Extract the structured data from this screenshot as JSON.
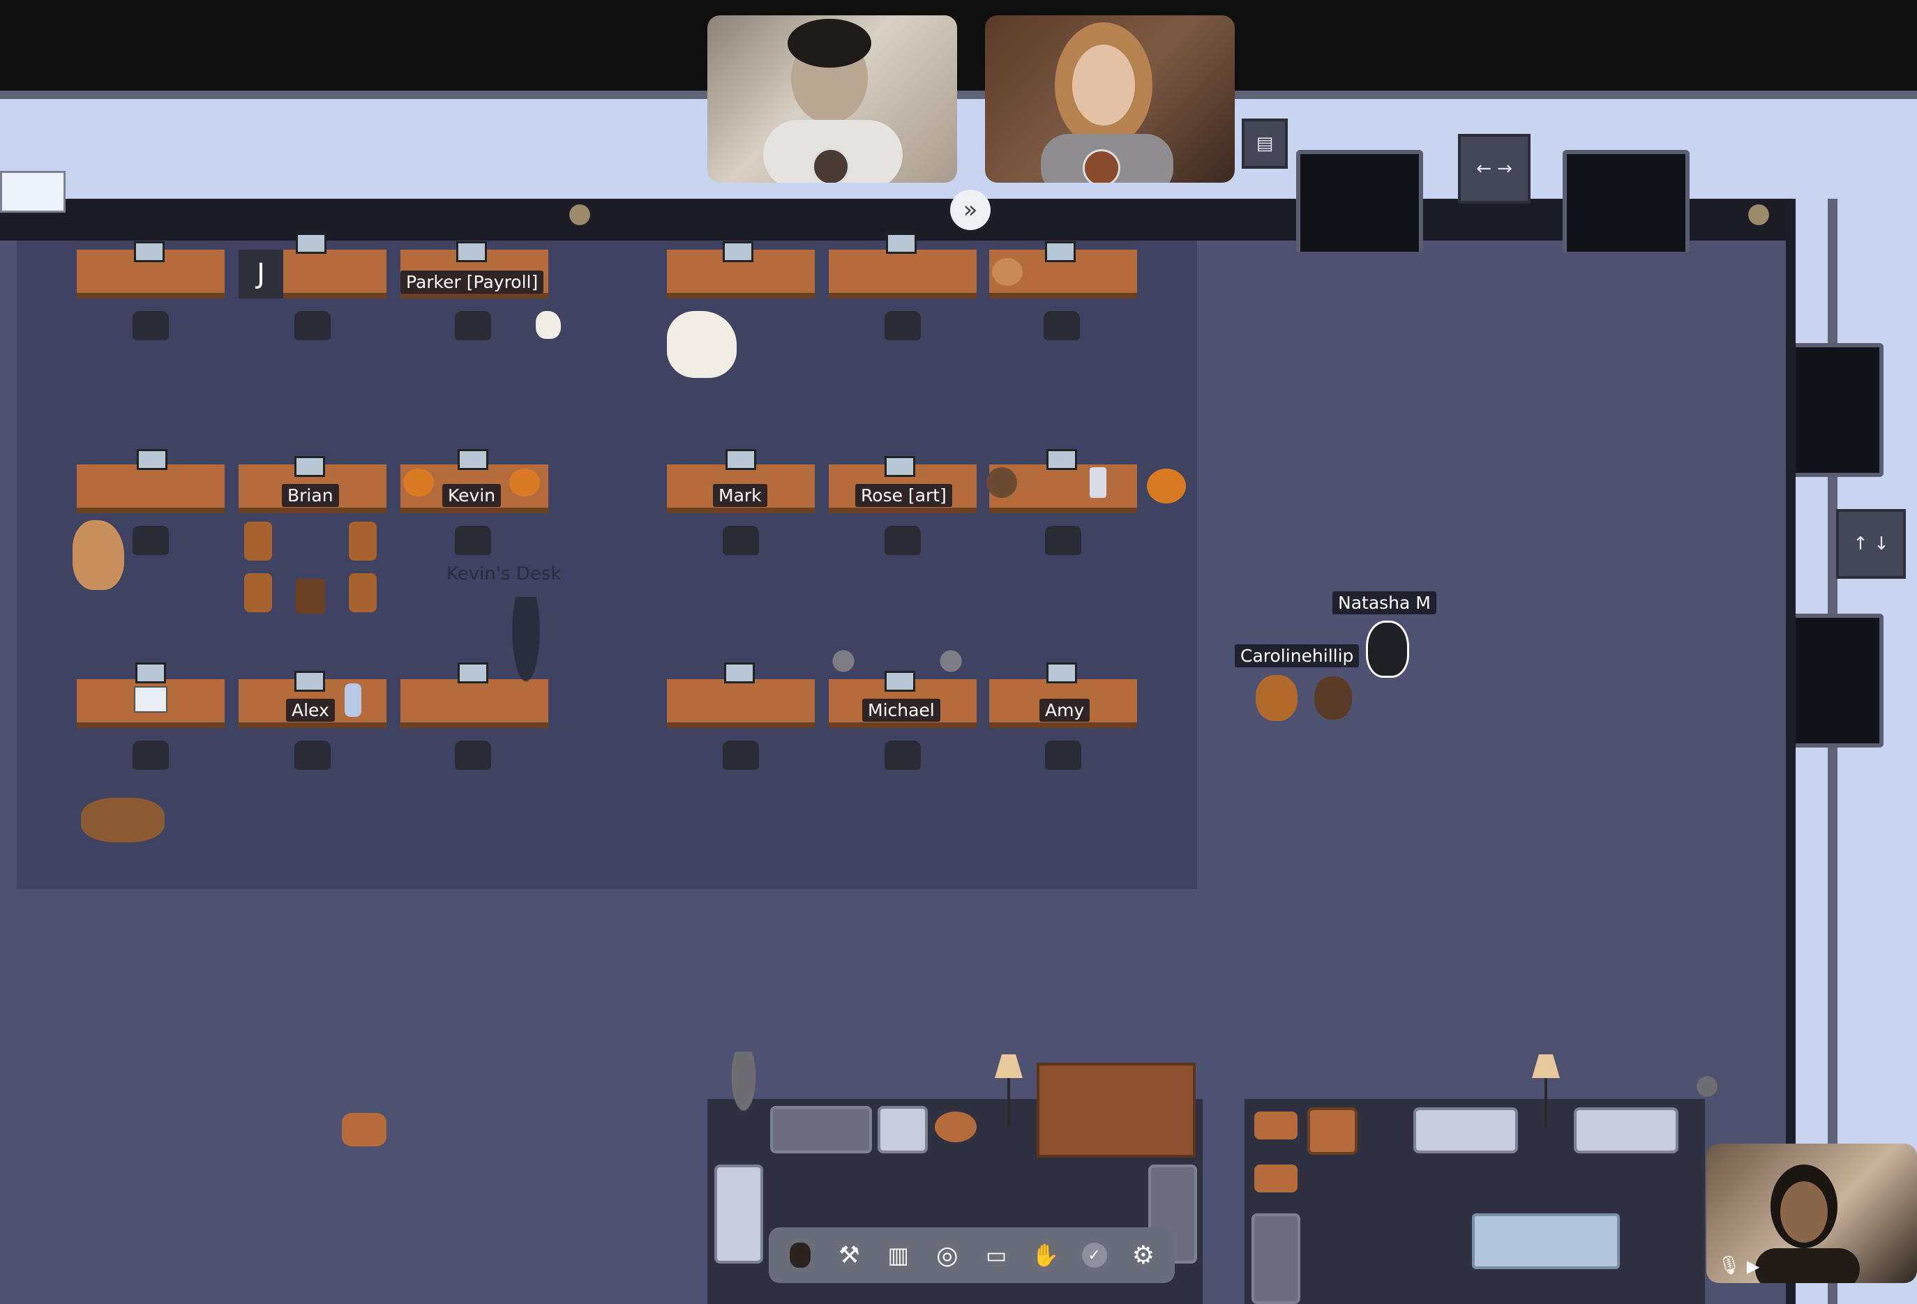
{
  "office": {
    "desk_labels": {
      "parker": "Parker [Payroll]",
      "brian": "Brian",
      "kevin": "Kevin",
      "mark": "Mark",
      "rose": "Rose [art]",
      "alex": "Alex",
      "michael": "Michael",
      "amy": "Amy",
      "j_initial": "J"
    },
    "kevins_desk_label": "Kevin's Desk"
  },
  "avatars": {
    "natasha": "Natasha M",
    "caroline": "Caroline",
    "phillip": "hillip"
  },
  "signs": {
    "left_right": "← →",
    "up_down": "↑ ↓"
  },
  "video_tiles": [
    {
      "name": "participant-1"
    },
    {
      "name": "participant-2"
    },
    {
      "name": "self-view"
    }
  ],
  "toolbar": {
    "items": [
      "avatar",
      "build",
      "map",
      "target",
      "screen-share",
      "hand-raise",
      "status-available",
      "settings"
    ]
  },
  "colors": {
    "office_floor": "#3f4260",
    "main_floor": "#4e5270",
    "desk_wood": "#b46c3c",
    "toolbar_bg": "#6a6d7a",
    "outer_floor": "#c9d4f1"
  }
}
